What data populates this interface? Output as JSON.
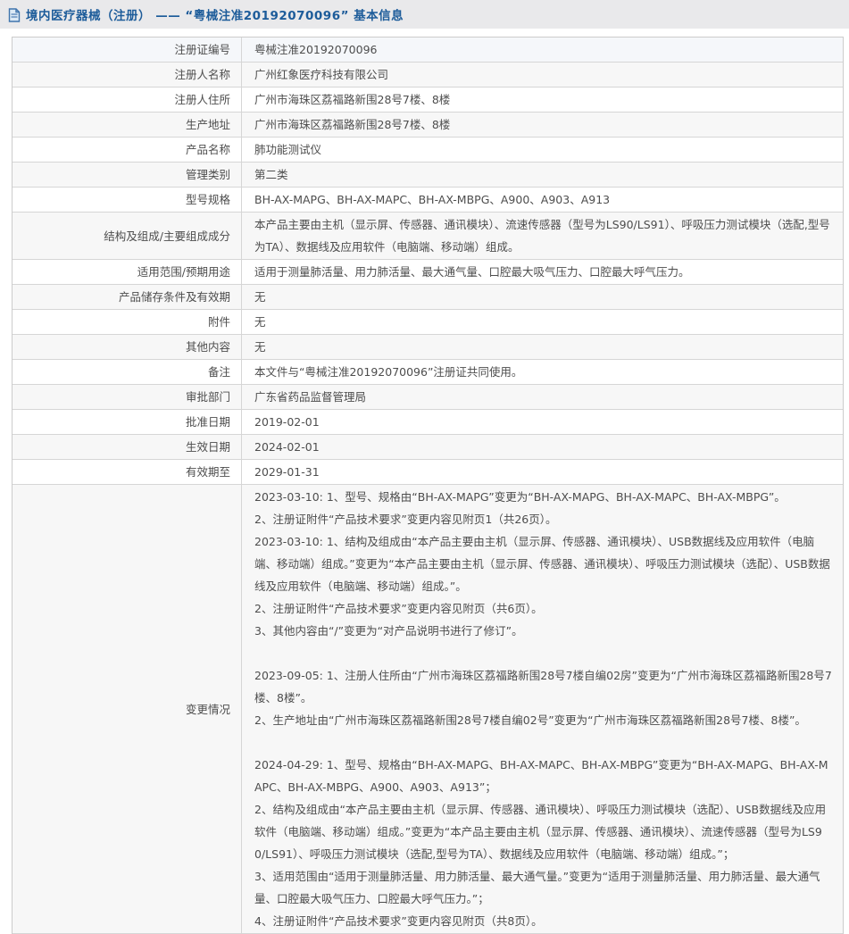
{
  "header": {
    "title": "境内医疗器械（注册） —— “粤械注准20192070096” 基本信息"
  },
  "colors": {
    "title_text": "#1d5c9a",
    "titlebar_bg": "#e9e9eb",
    "row_alt_bg": "#f7f7f7",
    "row_first_bg": "#f5f7fa",
    "border": "#cccccc",
    "body_text": "#4d4d4d"
  },
  "table": {
    "rows": [
      {
        "label": "注册证编号",
        "value": "粤械注准20192070096"
      },
      {
        "label": "注册人名称",
        "value": "广州红象医疗科技有限公司"
      },
      {
        "label": "注册人住所",
        "value": "广州市海珠区荔福路新围28号7楼、8楼"
      },
      {
        "label": "生产地址",
        "value": "广州市海珠区荔福路新围28号7楼、8楼"
      },
      {
        "label": "产品名称",
        "value": "肺功能测试仪"
      },
      {
        "label": "管理类别",
        "value": "第二类"
      },
      {
        "label": "型号规格",
        "value": "BH-AX-MAPG、BH-AX-MAPC、BH-AX-MBPG、A900、A903、A913"
      },
      {
        "label": "结构及组成/主要组成成分",
        "value": "本产品主要由主机（显示屏、传感器、通讯模块）、流速传感器（型号为LS90/LS91）、呼吸压力测试模块（选配,型号为TA）、数据线及应用软件（电脑端、移动端）组成。"
      },
      {
        "label": "适用范围/预期用途",
        "value": "适用于测量肺活量、用力肺活量、最大通气量、口腔最大吸气压力、口腔最大呼气压力。"
      },
      {
        "label": "产品储存条件及有效期",
        "value": "无"
      },
      {
        "label": "附件",
        "value": "无"
      },
      {
        "label": "其他内容",
        "value": "无"
      },
      {
        "label": "备注",
        "value": "本文件与“粤械注准20192070096”注册证共同使用。"
      },
      {
        "label": "审批部门",
        "value": "广东省药品监督管理局"
      },
      {
        "label": "批准日期",
        "value": "2019-02-01"
      },
      {
        "label": "生效日期",
        "value": "2024-02-01"
      },
      {
        "label": "有效期至",
        "value": "2029-01-31"
      },
      {
        "label": "变更情况",
        "value": "2023-03-10: 1、型号、规格由“BH-AX-MAPG”变更为“BH-AX-MAPG、BH-AX-MAPC、BH-AX-MBPG”。\n2、注册证附件“产品技术要求”变更内容见附页1（共26页）。\n2023-03-10: 1、结构及组成由“本产品主要由主机（显示屏、传感器、通讯模块）、USB数据线及应用软件（电脑端、移动端）组成。”变更为“本产品主要由主机（显示屏、传感器、通讯模块）、呼吸压力测试模块（选配）、USB数据线及应用软件（电脑端、移动端）组成。”。\n2、注册证附件“产品技术要求”变更内容见附页（共6页）。\n3、其他内容由“/”变更为“对产品说明书进行了修订”。\n\n2023-09-05: 1、注册人住所由“广州市海珠区荔福路新围28号7楼自编02房”变更为“广州市海珠区荔福路新围28号7楼、8楼”。\n2、生产地址由“广州市海珠区荔福路新围28号7楼自编02号”变更为“广州市海珠区荔福路新围28号7楼、8楼”。\n\n2024-04-29: 1、型号、规格由“BH-AX-MAPG、BH-AX-MAPC、BH-AX-MBPG”变更为“BH-AX-MAPG、BH-AX-MAPC、BH-AX-MBPG、A900、A903、A913”；\n2、结构及组成由“本产品主要由主机（显示屏、传感器、通讯模块）、呼吸压力测试模块（选配）、USB数据线及应用软件（电脑端、移动端）组成。”变更为“本产品主要由主机（显示屏、传感器、通讯模块）、流速传感器（型号为LS90/LS91）、呼吸压力测试模块（选配,型号为TA）、数据线及应用软件（电脑端、移动端）组成。”；\n3、适用范围由“适用于测量肺活量、用力肺活量、最大通气量。”变更为“适用于测量肺活量、用力肺活量、最大通气量、口腔最大吸气压力、口腔最大呼气压力。”；\n4、注册证附件“产品技术要求”变更内容见附页（共8页）。"
      }
    ]
  }
}
